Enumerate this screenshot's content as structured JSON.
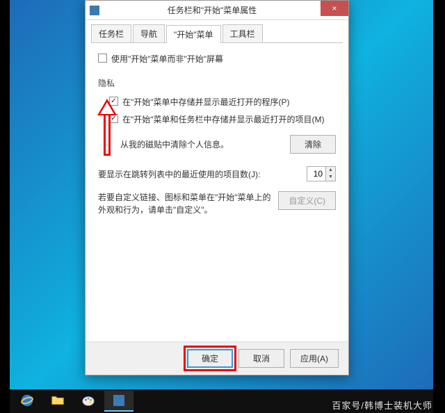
{
  "window": {
    "title": "任务栏和\"开始\"菜单属性",
    "close_label": "×"
  },
  "tabs": [
    {
      "label": "任务栏",
      "active": false
    },
    {
      "label": "导航",
      "active": false
    },
    {
      "label": "\"开始\"菜单",
      "active": true
    },
    {
      "label": "工具栏",
      "active": false
    }
  ],
  "main_checkbox": {
    "label": "使用\"开始\"菜单而非\"开始\"屏幕",
    "checked": false
  },
  "privacy": {
    "section_label": "隐私",
    "cb1": {
      "label": "在\"开始\"菜单中存储并显示最近打开的程序(P)",
      "checked": true
    },
    "cb2": {
      "label": "在\"开始\"菜单和任务栏中存储并显示最近打开的项目(M)",
      "checked": true
    },
    "clear_text": "从我的磁贴中清除个人信息。",
    "clear_btn": "清除"
  },
  "recent": {
    "label": "要显示在跳转列表中的最近使用的项目数(J):",
    "value": "10"
  },
  "customize": {
    "text": "若要自定义链接、图标和菜单在\"开始\"菜单上的外观和行为，请单击\"自定义\"。",
    "btn": "自定义(C)"
  },
  "footer": {
    "ok": "确定",
    "cancel": "取消",
    "apply": "应用(A)"
  },
  "watermark": "百家号/韩博士装机大师"
}
